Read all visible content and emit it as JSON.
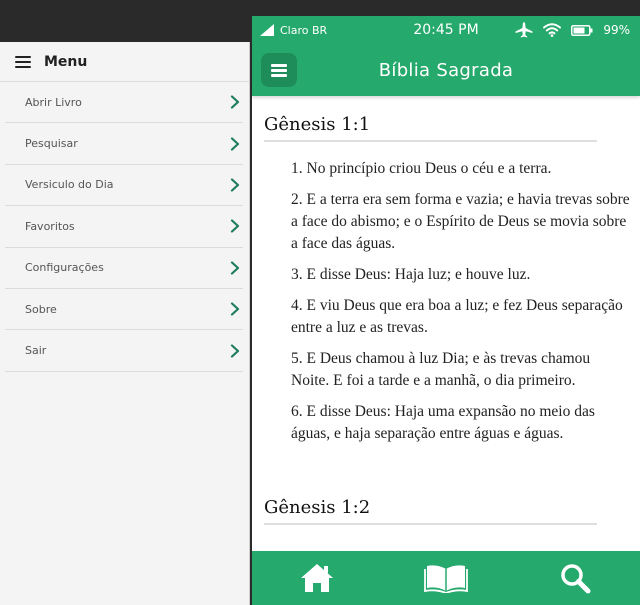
{
  "menu": {
    "title": "Menu",
    "items": [
      {
        "label": "Abrir Livro"
      },
      {
        "label": "Pesquisar"
      },
      {
        "label": "Versiculo do Dia"
      },
      {
        "label": "Favoritos"
      },
      {
        "label": "Configurações"
      },
      {
        "label": "Sobre"
      },
      {
        "label": "Sair"
      }
    ]
  },
  "status_bar": {
    "carrier": "Claro BR",
    "time": "20:45 PM",
    "battery": "99%"
  },
  "app_bar": {
    "title": "Bíblia Sagrada"
  },
  "reading": {
    "chapter_1": {
      "heading": "Gênesis 1:1",
      "verses": [
        "1. No princípio criou Deus o céu e a terra.",
        "2. E a terra era sem forma e vazia; e havia trevas sobre a face do abismo; e o Espírito de Deus se movia sobre a face das águas.",
        "3. E disse Deus: Haja luz; e houve luz.",
        "4. E viu Deus que era boa a luz; e fez Deus separação entre a luz e as trevas.",
        "5. E Deus chamou à luz Dia; e às trevas chamou Noite. E foi a tarde e a manhã, o dia primeiro.",
        "6. E disse Deus: Haja uma expansão no meio das águas, e haja separação entre águas e águas."
      ]
    },
    "chapter_2": {
      "heading": "Gênesis 1:2"
    }
  },
  "tabs": [
    "home-icon",
    "book-icon",
    "search-icon"
  ],
  "colors": {
    "primary": "#26a96c",
    "primary_dark": "#1f8d5a",
    "menu_background": "#f4f4f4",
    "chevron": "#1e7e5c"
  }
}
